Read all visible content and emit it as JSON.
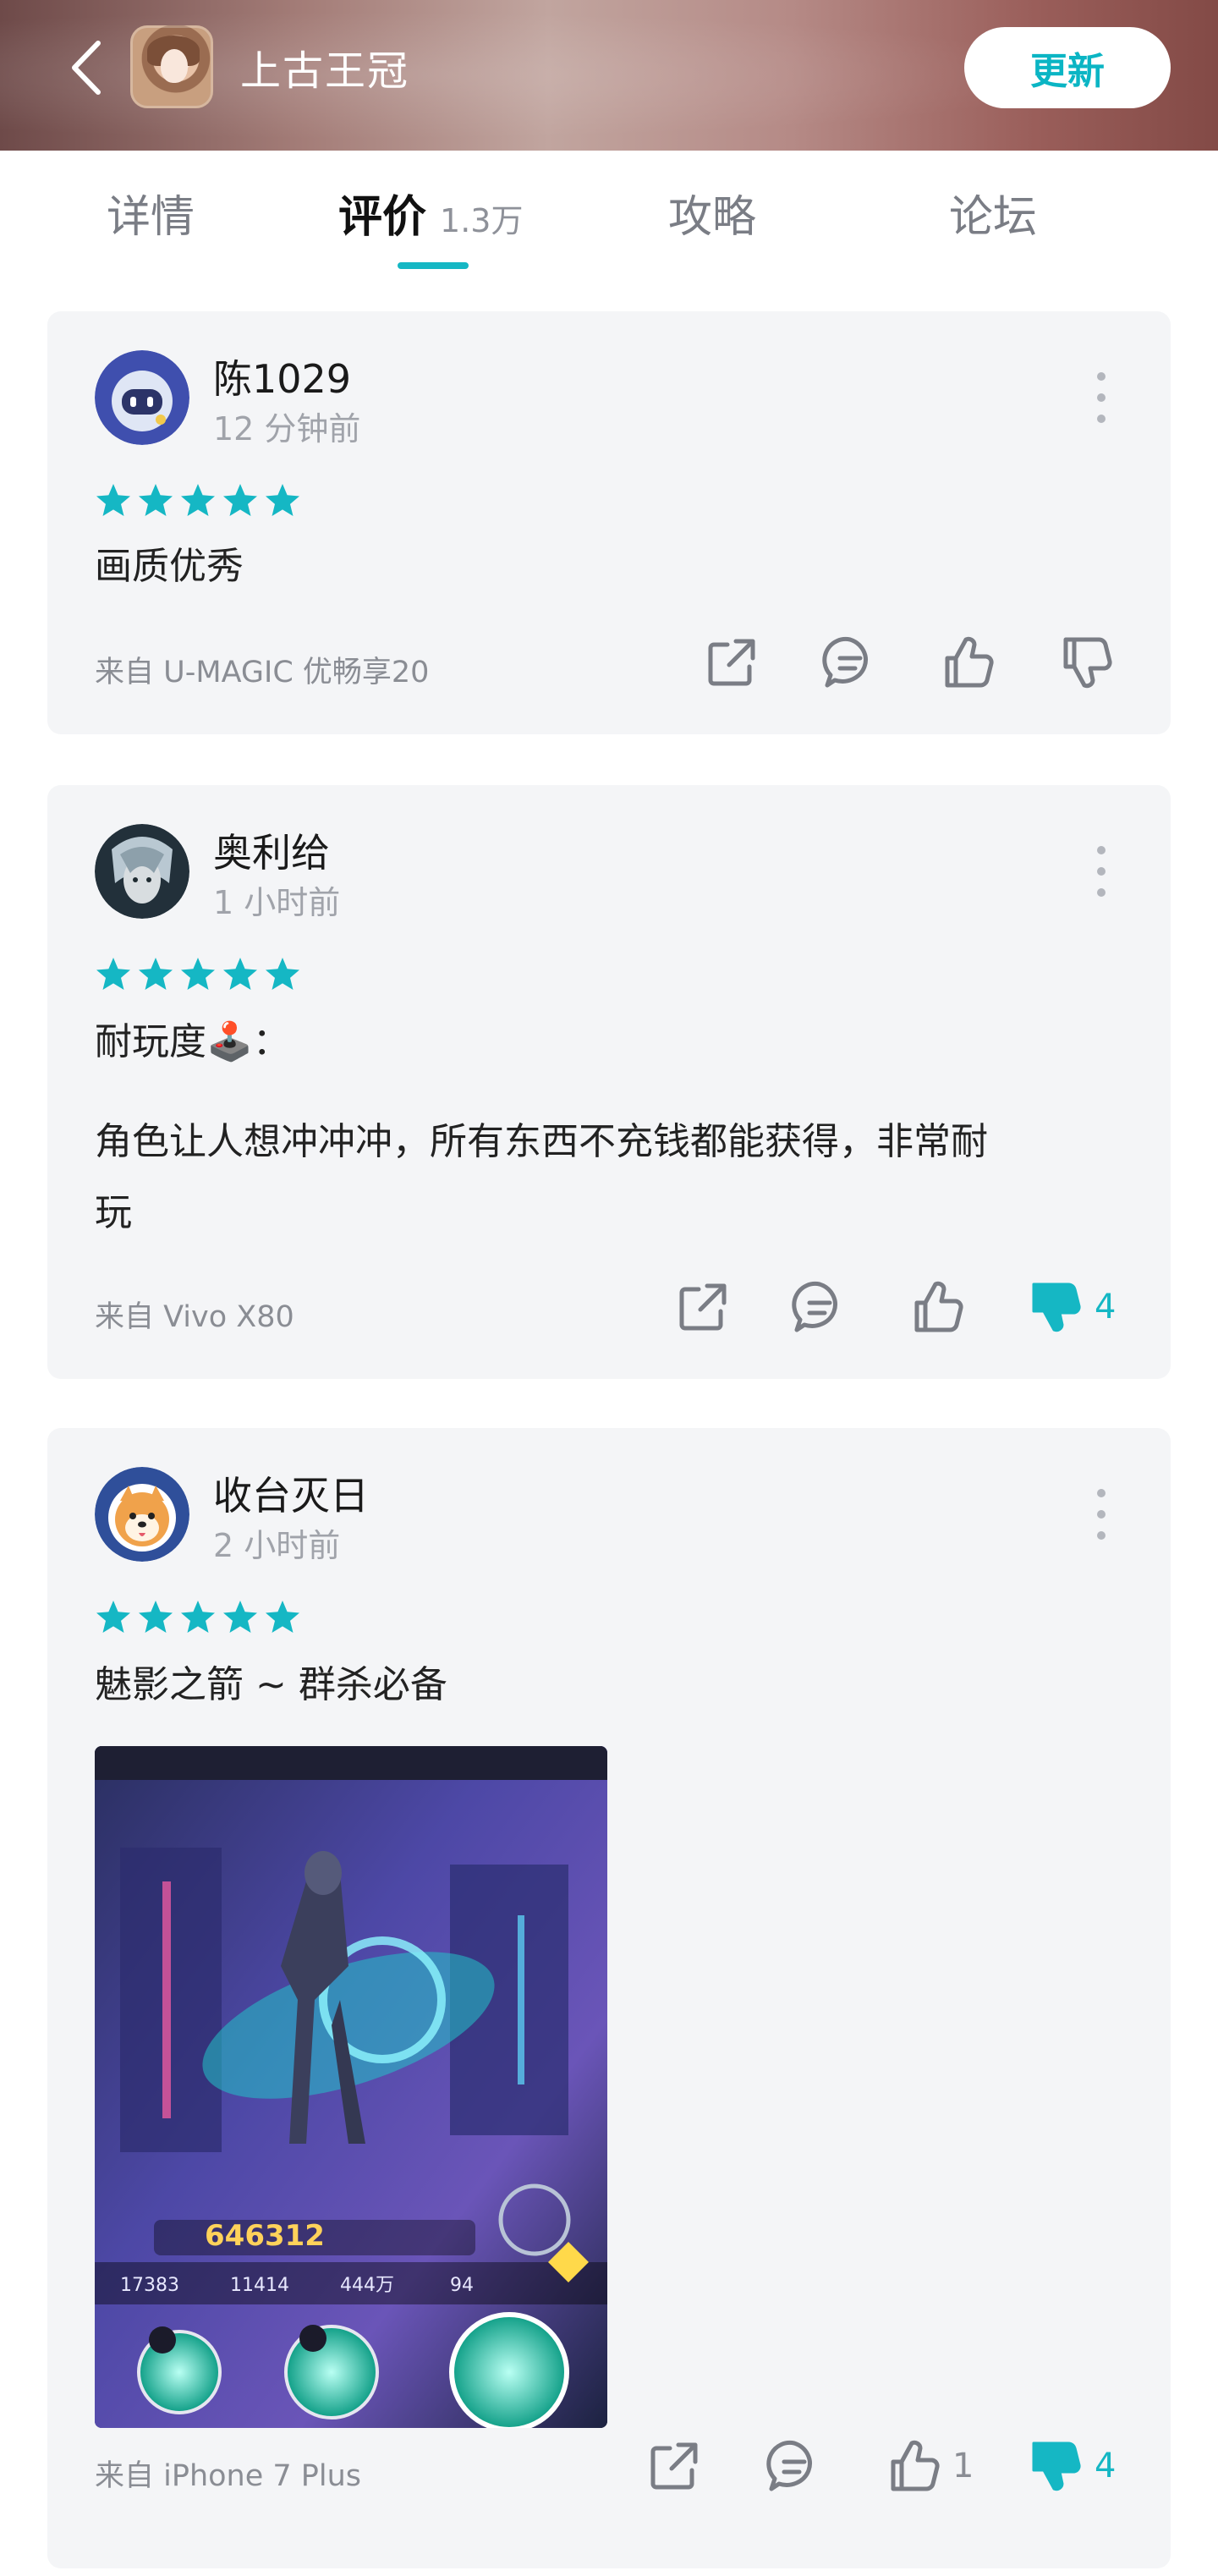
{
  "header": {
    "title": "上古王冠",
    "update_label": "更新",
    "gradient_colors": [
      "#6e4a49",
      "#c1a59f",
      "#834a46"
    ]
  },
  "tabs": [
    {
      "label": "详情",
      "active": false
    },
    {
      "label": "评价",
      "count": "1.3万",
      "active": true
    },
    {
      "label": "攻略",
      "active": false
    },
    {
      "label": "论坛",
      "active": false
    }
  ],
  "accent_color": "#15b7c4",
  "reviews": [
    {
      "user": "陈1029",
      "time": "12 分钟前",
      "rating": 5,
      "text": [
        "画质优秀"
      ],
      "device": "来自 U-MAGIC 优畅享20",
      "likes": "",
      "dislikes": "",
      "dislike_active": false
    },
    {
      "user": "奥利给",
      "time": "1 小时前",
      "rating": 5,
      "text": [
        "耐玩度🕹️：",
        "角色让人想冲冲冲，所有东西不充钱都能获得，非常耐",
        "玩"
      ],
      "device": "来自 Vivo X80",
      "likes": "",
      "dislikes": "4",
      "dislike_active": true
    },
    {
      "user": "收台灭日",
      "time": "2 小时前",
      "rating": 5,
      "text": [
        "魅影之箭 ~ 群杀必备"
      ],
      "image": {
        "power": "646312",
        "stat1": "17383",
        "stat2": "11414",
        "stat3": "444万",
        "stat4": "94"
      },
      "device": "来自 iPhone 7 Plus",
      "likes": "1",
      "dislikes": "4",
      "dislike_active": true
    }
  ]
}
